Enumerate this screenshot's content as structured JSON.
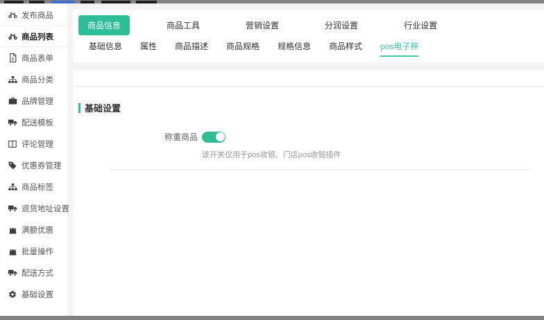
{
  "sidebar": {
    "items": [
      {
        "label": "发布商品",
        "icon": "motorcycle-icon",
        "active": false
      },
      {
        "label": "商品列表",
        "icon": "motorcycle-icon",
        "active": true
      },
      {
        "label": "商品表单",
        "icon": "file-icon",
        "active": false
      },
      {
        "label": "商品分类",
        "icon": "sitemap-icon",
        "active": false
      },
      {
        "label": "品牌管理",
        "icon": "briefcase-icon",
        "active": false
      },
      {
        "label": "配送模板",
        "icon": "truck-icon",
        "active": false
      },
      {
        "label": "评论管理",
        "icon": "columns-icon",
        "active": false
      },
      {
        "label": "优惠券管理",
        "icon": "tag-icon",
        "active": false
      },
      {
        "label": "商品标签",
        "icon": "sitemap-icon",
        "active": false
      },
      {
        "label": "退货地址设置",
        "icon": "truck-icon",
        "active": false
      },
      {
        "label": "满额优惠",
        "icon": "bag-icon",
        "active": false
      },
      {
        "label": "批量操作",
        "icon": "bag-icon",
        "active": false
      },
      {
        "label": "配送方式",
        "icon": "truck-icon",
        "active": false
      },
      {
        "label": "基础设置",
        "icon": "gear-icon",
        "active": false
      }
    ]
  },
  "tabs_primary": {
    "items": [
      {
        "label": "商品信息",
        "active": true
      },
      {
        "label": "商品工具",
        "active": false
      },
      {
        "label": "营销设置",
        "active": false
      },
      {
        "label": "分润设置",
        "active": false
      },
      {
        "label": "行业设置",
        "active": false
      }
    ]
  },
  "tabs_secondary": {
    "items": [
      {
        "label": "基础信息",
        "active": false
      },
      {
        "label": "属性",
        "active": false
      },
      {
        "label": "商品描述",
        "active": false
      },
      {
        "label": "商品规格",
        "active": false
      },
      {
        "label": "规格信息",
        "active": false
      },
      {
        "label": "商品样式",
        "active": false
      },
      {
        "label": "pos电子秤",
        "active": true
      }
    ]
  },
  "content": {
    "section_title": "基础设置",
    "form": {
      "label": "称重商品",
      "toggle_state": "on",
      "hint": "该开关仅用于pos收银、门店pos收银插件"
    }
  },
  "colors": {
    "accent": "#2ebe96",
    "accent_light": "#3ec7a2",
    "chrome_strip": "#828282"
  }
}
